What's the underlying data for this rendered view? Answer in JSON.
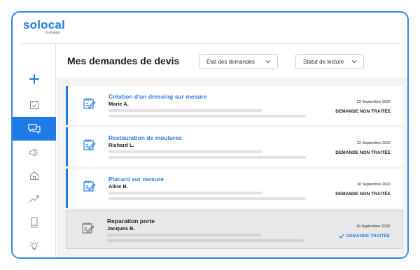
{
  "brand": {
    "name": "solocal",
    "sub": "manager"
  },
  "page": {
    "title": "Mes demandes de devis"
  },
  "filters": [
    {
      "label": "État des demandes"
    },
    {
      "label": "Statut de lecture"
    }
  ],
  "sidebar": {
    "items": [
      {
        "icon": "plus-icon",
        "active": false
      },
      {
        "icon": "calendar-icon",
        "active": false
      },
      {
        "icon": "chat-icon",
        "active": true
      },
      {
        "icon": "megaphone-icon",
        "active": false
      },
      {
        "icon": "home-icon",
        "active": false
      },
      {
        "icon": "trend-icon",
        "active": false
      },
      {
        "icon": "mobile-icon",
        "active": false
      },
      {
        "icon": "lightbulb-icon",
        "active": false
      }
    ]
  },
  "requests": [
    {
      "title": "Création d'un dressing sur mesure",
      "name": "Marie A.",
      "date": "23 Septembre 2020",
      "status": "DEMANDE NON TRAITÉE",
      "done": false
    },
    {
      "title": "Restauration de moulures",
      "name": "Richard L.",
      "date": "22 Septembre 2020",
      "status": "DEMANDE NON TRAITÉE",
      "done": false
    },
    {
      "title": "Placard sur mesure",
      "name": "Aline B.",
      "date": "18 Septembre 2020",
      "status": "DEMANDE NON TRAITÉE",
      "done": false
    },
    {
      "title": "Reparation porte",
      "name": "Jacques B.",
      "date": "16 Septembre 2020",
      "status": "DEMANDE TRAITÉE",
      "done": true
    }
  ],
  "colors": {
    "accent": "#1f7ae6",
    "frame": "#2f86f0"
  }
}
